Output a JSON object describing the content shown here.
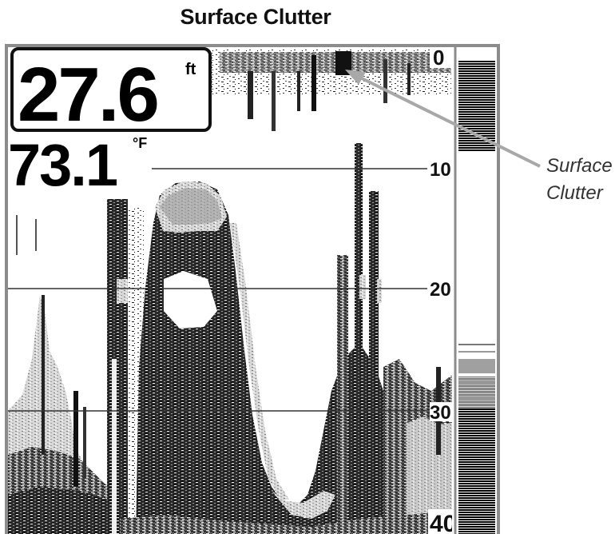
{
  "title": "Surface Clutter",
  "readouts": {
    "depth_value": "27.6",
    "depth_unit": "ft",
    "temperature_value": "73.1",
    "temperature_unit": "°F"
  },
  "depth_scale": [
    "0",
    "10",
    "20",
    "30",
    "40"
  ],
  "callout": {
    "line1": "Surface",
    "line2": "Clutter"
  },
  "colors": {
    "frame": "#8c8c8c",
    "sonar_dark": "#111111",
    "sonar_gray": "#8a8a8a",
    "callout_arrow": "#a8a8a8"
  }
}
